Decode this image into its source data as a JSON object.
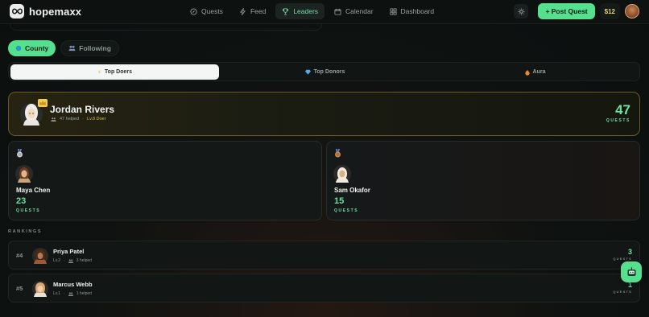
{
  "app": {
    "name": "hopemaxx"
  },
  "nav": {
    "items": [
      {
        "label": "Quests",
        "icon": "compass-icon"
      },
      {
        "label": "Feed",
        "icon": "bolt-icon"
      },
      {
        "label": "Leaders",
        "icon": "trophy-icon",
        "active": true
      },
      {
        "label": "Calendar",
        "icon": "calendar-icon"
      },
      {
        "label": "Dashboard",
        "icon": "grid-icon"
      }
    ]
  },
  "header": {
    "post_quest_label": "+ Post Quest",
    "balance": "$12"
  },
  "scope": {
    "county_label": "County",
    "following_label": "Following",
    "active": "County"
  },
  "tabs": [
    {
      "label": "Top Doers",
      "icon": "bolt-icon",
      "active": true
    },
    {
      "label": "Top Donors",
      "icon": "diamond-icon"
    },
    {
      "label": "Aura",
      "icon": "flame-icon"
    }
  ],
  "champion": {
    "name": "Jordan Rivers",
    "helped": "47 helped",
    "level": "Lv.8 Doer",
    "score": "47",
    "score_label": "QUESTS"
  },
  "podium": [
    {
      "rank_medal": "silver",
      "name": "Maya Chen",
      "score": "23",
      "score_label": "QUESTS"
    },
    {
      "rank_medal": "bronze",
      "name": "Sam Okafor",
      "score": "15",
      "score_label": "QUESTS"
    }
  ],
  "rankings": {
    "title": "RANKINGS",
    "rows": [
      {
        "rank": "#4",
        "name": "Priya Patel",
        "level": "Lv.2",
        "helped": "3 helped",
        "score": "3",
        "score_label": "QUESTS"
      },
      {
        "rank": "#5",
        "name": "Marcus Webb",
        "level": "Lv.1",
        "helped": "1 helped",
        "score": "1",
        "score_label": "QUESTS"
      }
    ]
  },
  "colors": {
    "accent": "#54e08e",
    "gold": "#d8b94c",
    "background": "#0d1110"
  }
}
